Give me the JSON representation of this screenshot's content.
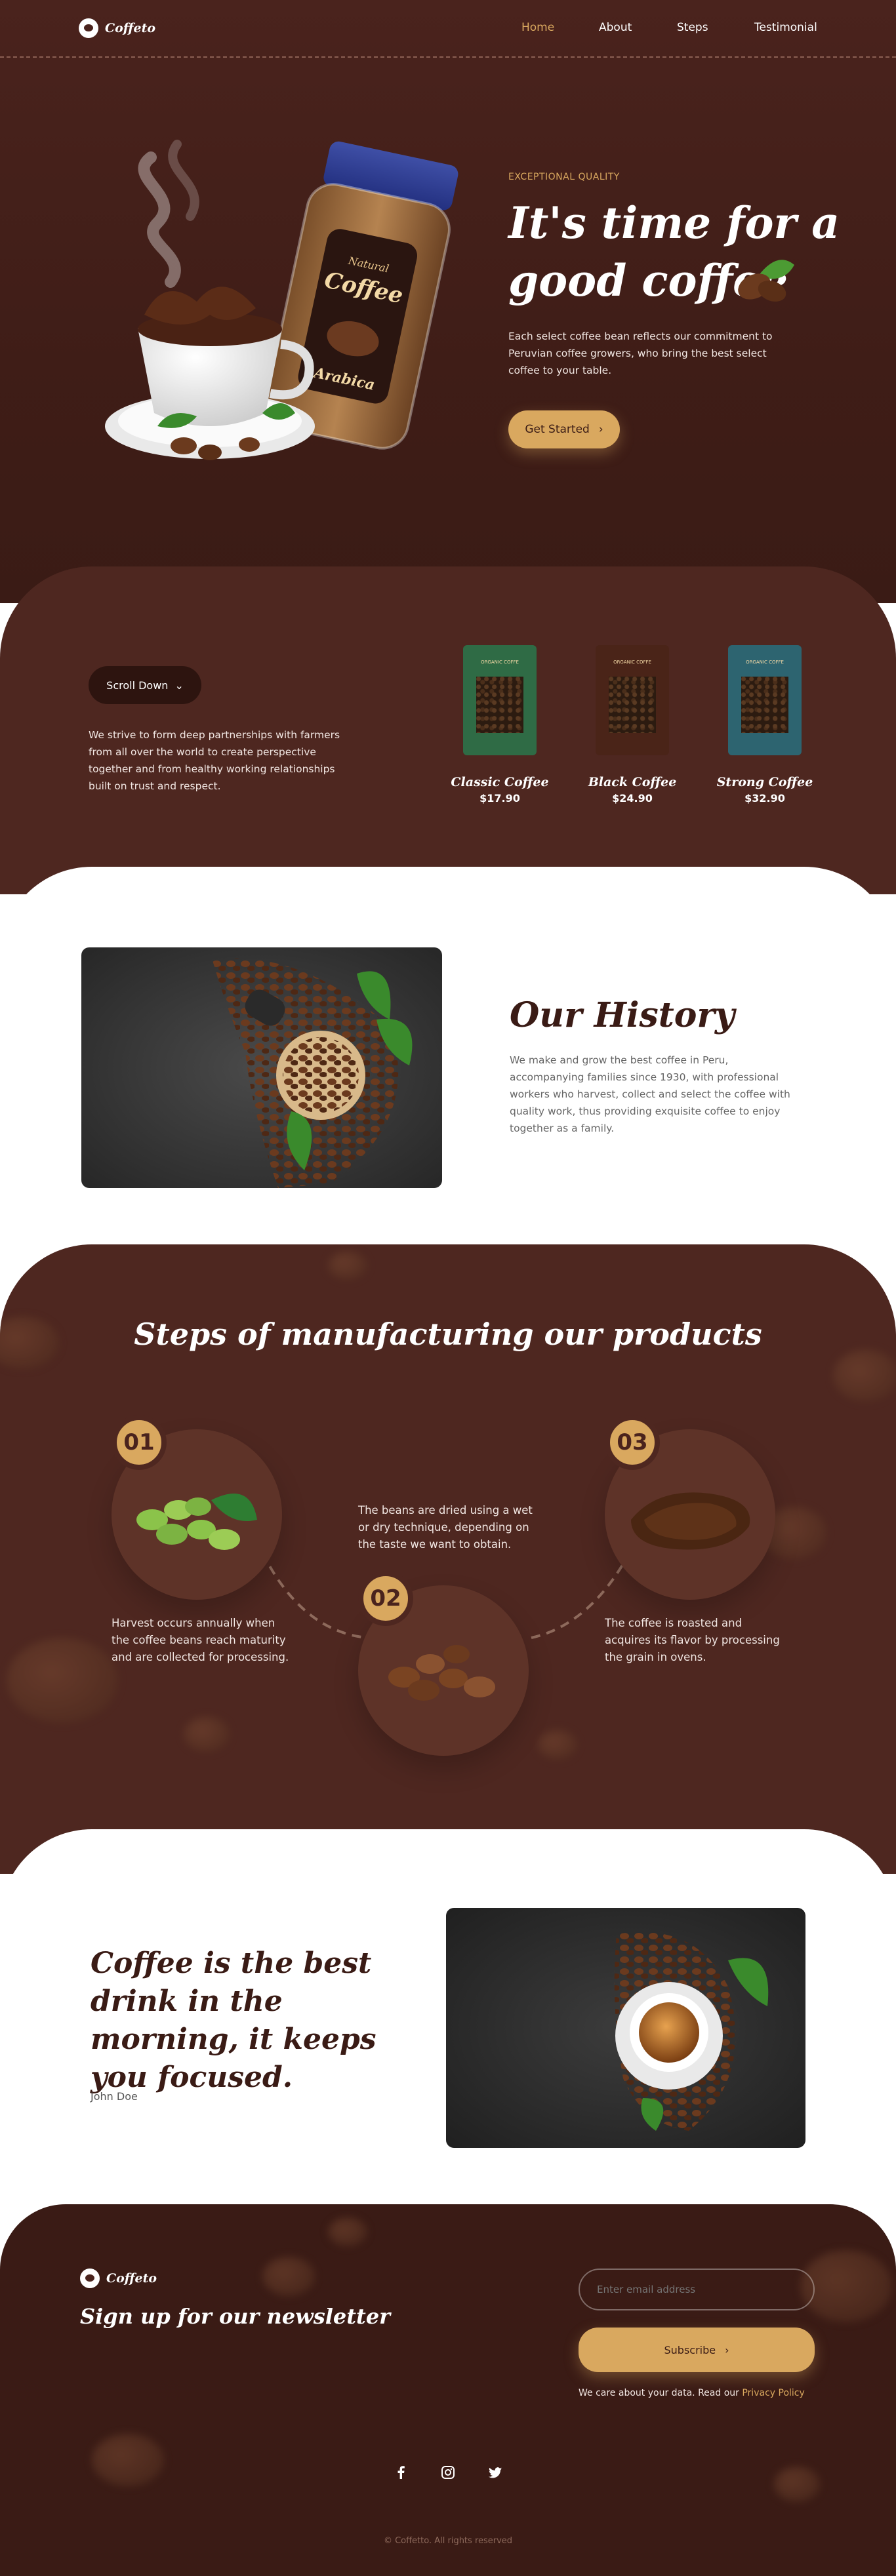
{
  "brand": {
    "name": "Coffeto"
  },
  "nav": {
    "items": [
      "Home",
      "About",
      "Steps",
      "Testimonial"
    ],
    "active_color": "#d9a85f"
  },
  "hero": {
    "eyebrow": "EXCEPTIONAL QUALITY",
    "title_line1": "It's time for a",
    "title_line2": "good coffee",
    "description": "Each select coffee bean reflects our commitment to Peruvian coffee growers, who bring the best select coffee to your table.",
    "cta": "Get Started",
    "jar_label_top": "Natural",
    "jar_label_main": "Coffee",
    "jar_label_bottom": "Arabica"
  },
  "products": {
    "scroll_button": "Scroll Down",
    "description": "We strive to form deep partnerships with farmers from all over the world to create perspective together and from healthy working relationships built on trust and respect.",
    "bag_label": "ORGANIC COFFE",
    "items": [
      {
        "name": "Classic Coffee",
        "price": "$17.90",
        "color": "#2f6b45"
      },
      {
        "name": "Black Coffee",
        "price": "$24.90",
        "color": "#4a2418"
      },
      {
        "name": "Strong Coffee",
        "price": "$32.90",
        "color": "#2d6470"
      }
    ]
  },
  "history": {
    "title": "Our History",
    "body": "We make and grow the best coffee in Peru, accompanying families since 1930, with professional workers who harvest, collect and select the coffee with quality work, thus providing exquisite coffee to enjoy together as a family."
  },
  "steps": {
    "title": "Steps of manufacturing our products",
    "items": [
      {
        "num": "01",
        "text": "Harvest occurs annually when the coffee beans reach maturity and are collected for processing."
      },
      {
        "num": "02",
        "text": "The beans are dried using a wet or dry technique, depending on the taste we want to obtain."
      },
      {
        "num": "03",
        "text": "The coffee is roasted and acquires its flavor by processing the grain in ovens."
      }
    ]
  },
  "quote": {
    "text": "Coffee is the best drink in the morning, it keeps you focused.",
    "author": "John Doe"
  },
  "footer": {
    "newsletter_title": "Sign up for our newsletter",
    "email_placeholder": "Enter email address",
    "subscribe": "Subscribe",
    "privacy_text": "We care about your data. Read our",
    "privacy_link": "Privacy Policy",
    "copyright": "© Coffetto. All rights reserved"
  }
}
